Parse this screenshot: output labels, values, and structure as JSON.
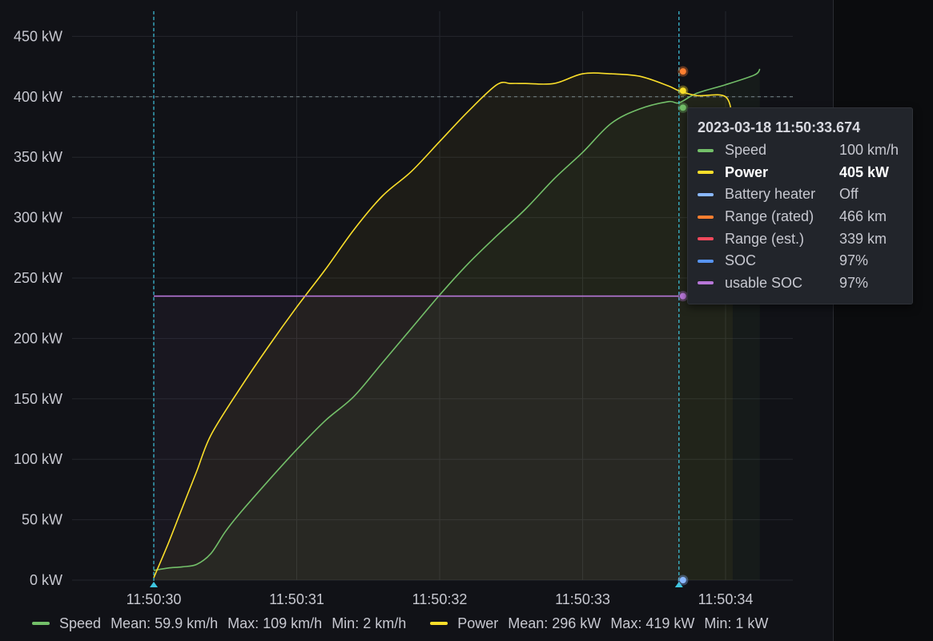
{
  "chart_data": {
    "type": "line",
    "y_axis": {
      "unit": "kW",
      "ticks": [
        "0 kW",
        "50 kW",
        "100 kW",
        "150 kW",
        "200 kW",
        "250 kW",
        "300 kW",
        "350 kW",
        "400 kW",
        "450 kW"
      ],
      "tick_values": [
        0,
        50,
        100,
        150,
        200,
        250,
        300,
        350,
        400,
        450
      ],
      "range": [
        0,
        470
      ],
      "threshold": 400
    },
    "x_axis": {
      "ticks": [
        "11:50:30",
        "11:50:31",
        "11:50:32",
        "11:50:33",
        "11:50:34"
      ],
      "tick_values": [
        30,
        31,
        32,
        33,
        34
      ],
      "range": [
        29.38,
        34.48
      ],
      "unit": "seconds (11:50:SS)"
    },
    "grid": true,
    "annotations": {
      "start_marker_time": "11:50:30",
      "hover_time": "11:50:33.674"
    },
    "series": [
      {
        "name": "Speed",
        "color": "#73bf69",
        "x": [
          30.0,
          30.1,
          30.2,
          30.3,
          30.4,
          30.5,
          30.6,
          30.8,
          31.0,
          31.2,
          31.4,
          31.6,
          31.8,
          32.0,
          32.2,
          32.4,
          32.6,
          32.8,
          33.0,
          33.2,
          33.4,
          33.6,
          33.674,
          33.8,
          34.0,
          34.2,
          34.24
        ],
        "y": [
          8,
          10,
          11,
          13,
          22,
          40,
          55,
          82,
          108,
          132,
          152,
          180,
          208,
          236,
          262,
          285,
          307,
          332,
          354,
          378,
          390,
          396,
          395,
          403,
          410,
          418,
          423
        ]
      },
      {
        "name": "Power",
        "color": "#fade2a",
        "x": [
          30.0,
          30.1,
          30.2,
          30.3,
          30.4,
          30.6,
          30.8,
          31.0,
          31.2,
          31.4,
          31.6,
          31.8,
          32.0,
          32.2,
          32.4,
          32.5,
          32.6,
          32.8,
          33.0,
          33.2,
          33.4,
          33.6,
          33.674,
          33.8,
          34.0,
          34.05
        ],
        "y": [
          2,
          30,
          60,
          90,
          120,
          158,
          193,
          226,
          257,
          290,
          318,
          338,
          363,
          388,
          410,
          411,
          411,
          411,
          419,
          419,
          417,
          409,
          405,
          401,
          400,
          380
        ]
      },
      {
        "name": "usable SOC",
        "color": "#b877d9",
        "x": [
          30.0,
          33.674
        ],
        "y": [
          235,
          235
        ]
      }
    ],
    "hover_points": [
      {
        "series": "Range (rated)",
        "y": 421,
        "color": "#ff7f30"
      },
      {
        "series": "Power",
        "y": 405,
        "color": "#fade2a"
      },
      {
        "series": "Speed",
        "y": 391,
        "color": "#73bf69"
      },
      {
        "series": "usable SOC",
        "y": 235,
        "color": "#b877d9"
      },
      {
        "series": "Battery heater",
        "y": 0,
        "color": "#8ab8ff"
      }
    ]
  },
  "tooltip": {
    "time": "2023-03-18 11:50:33.674",
    "rows": [
      {
        "name": "Speed",
        "value": "100 km/h",
        "color": "#73bf69",
        "bold": false
      },
      {
        "name": "Power",
        "value": "405 kW",
        "color": "#fade2a",
        "bold": true
      },
      {
        "name": "Battery heater",
        "value": "Off",
        "color": "#8ab8ff",
        "bold": false
      },
      {
        "name": "Range (rated)",
        "value": "466 km",
        "color": "#ff7f30",
        "bold": false
      },
      {
        "name": "Range (est.)",
        "value": "339 km",
        "color": "#f2495c",
        "bold": false
      },
      {
        "name": "SOC",
        "value": "97%",
        "color": "#5794f2",
        "bold": false
      },
      {
        "name": "usable SOC",
        "value": "97%",
        "color": "#b877d9",
        "bold": false
      }
    ]
  },
  "legend": [
    {
      "name": "Speed",
      "color": "#73bf69",
      "mean": "Mean: 59.9 km/h",
      "max": "Max: 109 km/h",
      "min": "Min: 2 km/h"
    },
    {
      "name": "Power",
      "color": "#fade2a",
      "mean": "Mean: 296 kW",
      "max": "Max: 419 kW",
      "min": "Min: 1 kW"
    }
  ]
}
